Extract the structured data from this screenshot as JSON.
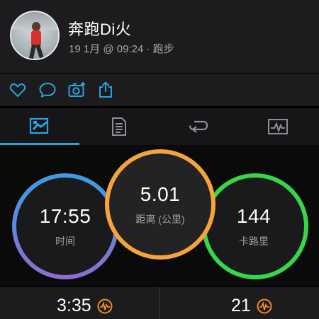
{
  "header": {
    "user_name": "奔跑Di火",
    "activity_meta": "19 1月 @ 09:24 · 跑步"
  },
  "actions": [
    "like-icon",
    "comment-icon",
    "add-photo-icon",
    "share-icon"
  ],
  "tabs": [
    {
      "icon": "overview-icon",
      "active": true
    },
    {
      "icon": "details-icon",
      "active": false
    },
    {
      "icon": "laps-icon",
      "active": false
    },
    {
      "icon": "charts-icon",
      "active": false
    }
  ],
  "summary": {
    "time": {
      "value": "17:55",
      "label": "时间"
    },
    "distance": {
      "value": "5.01",
      "label": "距离 (公里)"
    },
    "calories": {
      "value": "144",
      "label": "卡路里"
    }
  },
  "stats": {
    "pace": "3:35",
    "other": "21"
  },
  "colors": {
    "accent": "#2aa4de",
    "ring_time_top": "#3a9ee0",
    "ring_time_bottom": "#8a6fd1",
    "ring_distance": "#f5a33a",
    "ring_calories": "#36d64a",
    "hr_icon": "#f08a24"
  }
}
